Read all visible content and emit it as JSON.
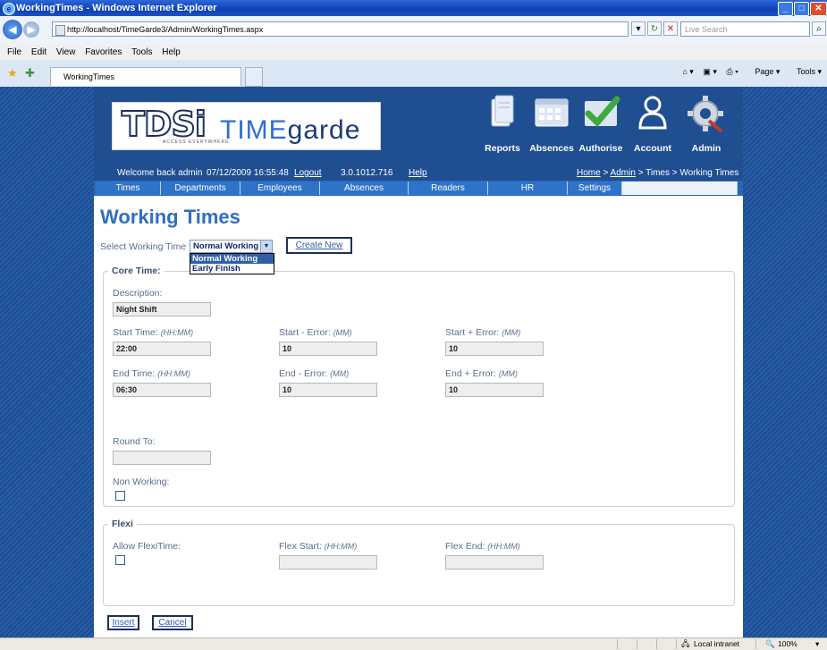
{
  "window": {
    "title": "WorkingTimes - Windows Internet Explorer",
    "url": "http://localhost/TimeGarde3/Admin/WorkingTimes.aspx",
    "search_placeholder": "Live Search",
    "menu": [
      "File",
      "Edit",
      "View",
      "Favorites",
      "Tools",
      "Help"
    ],
    "tab_title": "WorkingTimes",
    "command_items": [
      "Page",
      "Tools"
    ]
  },
  "header": {
    "logo_main": "TDSi",
    "logo_tagline": "ACCESS EVERYWHERE",
    "logo_product_a": "TIME",
    "logo_product_b": "garde",
    "nav": [
      "Reports",
      "Absences",
      "Authorise",
      "Account",
      "Admin"
    ]
  },
  "welcome": {
    "text": "Welcome back admin",
    "datetime": "07/12/2009 16:55:48",
    "logout": "Logout",
    "version": "3.0.1012.716",
    "help": "Help",
    "breadcrumb_home": "Home",
    "breadcrumb_sep1": ">",
    "breadcrumb_admin": "Admin",
    "breadcrumb_rest": "> Times > Working Times"
  },
  "tabs": [
    "Times",
    "Departments",
    "Employees",
    "Absences",
    "Readers",
    "HR",
    "Settings",
    ""
  ],
  "page": {
    "title": "Working Times",
    "select_label": "Select Working Time",
    "select_value": "Normal Working",
    "dropdown_options": [
      "Normal Working",
      "Early Finish"
    ],
    "create_new": "Create New"
  },
  "core": {
    "legend": "Core Time:",
    "description_label": "Description:",
    "description_value": "Night Shift",
    "start_time_label": "Start Time:",
    "start_time_hint": "(HH:MM)",
    "start_time_value": "22:00",
    "start_minus_label": "Start - Error:",
    "start_minus_hint": "(MM)",
    "start_minus_value": "10",
    "start_plus_label": "Start + Error:",
    "start_plus_hint": "(MM)",
    "start_plus_value": "10",
    "end_time_label": "End Time:",
    "end_time_hint": "(HH:MM)",
    "end_time_value": "06:30",
    "end_minus_label": "End - Error:",
    "end_minus_hint": "(MM)",
    "end_minus_value": "10",
    "end_plus_label": "End + Error:",
    "end_plus_hint": "(MM)",
    "end_plus_value": "10",
    "round_to_label": "Round To:",
    "round_to_value": "",
    "non_working_label": "Non Working:"
  },
  "flexi": {
    "legend": "Flexi",
    "allow_label": "Allow FlexiTime:",
    "flex_start_label": "Flex Start:",
    "flex_start_hint": "(HH:MM)",
    "flex_end_label": "Flex End:",
    "flex_end_hint": "(HH:MM)"
  },
  "actions": {
    "insert": "Insert",
    "cancel": "Cancel"
  },
  "status": {
    "zone": "Local intranet",
    "zoom": "100%"
  },
  "colors": {
    "brand_blue": "#1f4f91",
    "heading_blue": "#2f6fc3",
    "label_gray": "#5a6f8c"
  }
}
